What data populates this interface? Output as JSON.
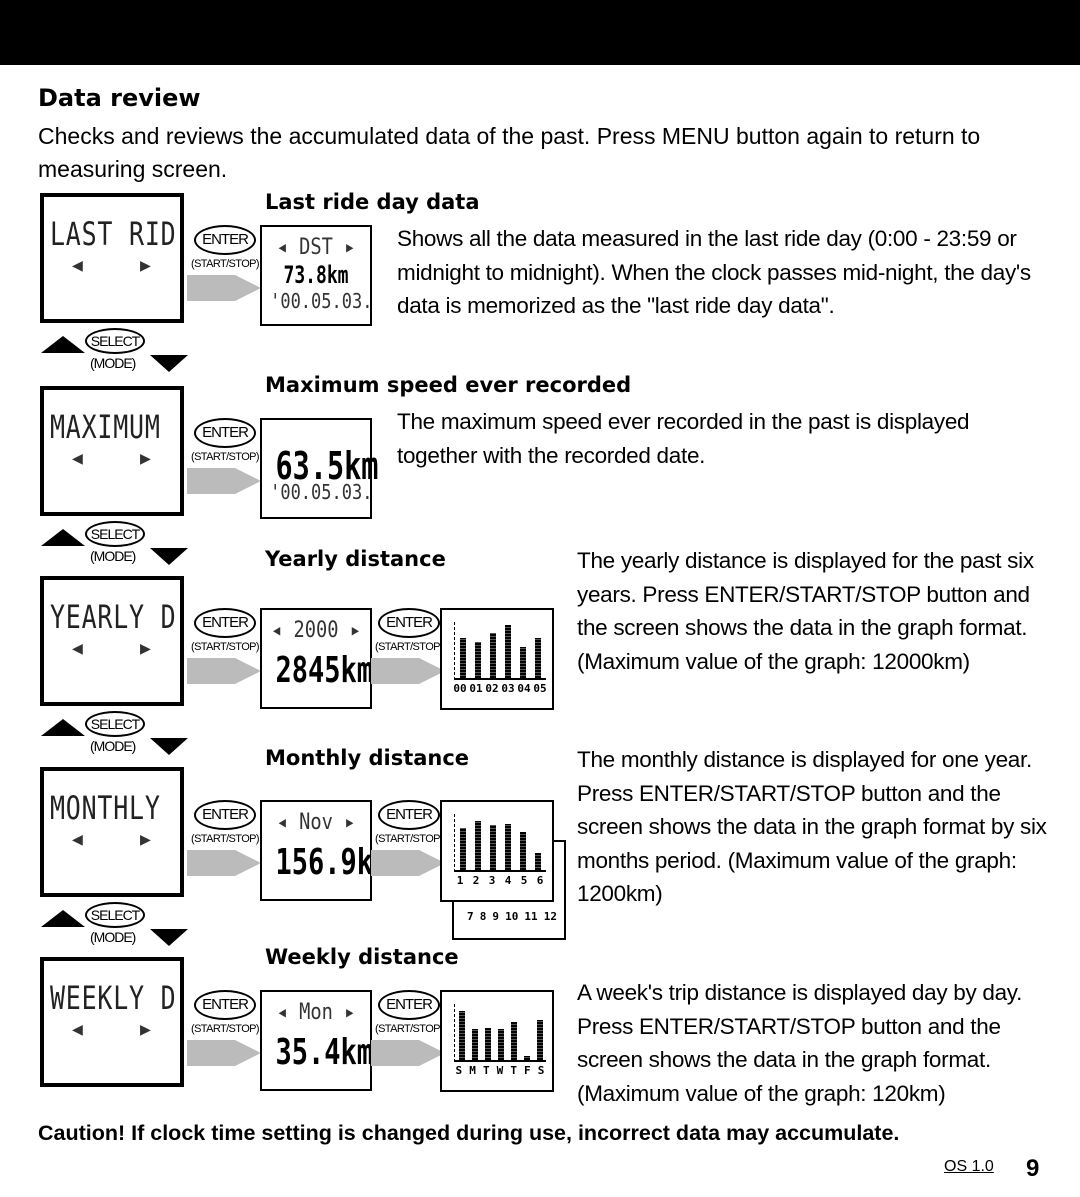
{
  "title": "Data review",
  "intro": "Checks and reviews the accumulated data of the past. Press MENU button again to return to measuring screen.",
  "buttons": {
    "enter": "ENTER",
    "start_stop": "(START/STOP)",
    "select": "SELECT",
    "mode": "(MODE)"
  },
  "sections": [
    {
      "title": "Last ride day data",
      "lcd": "LAST RID",
      "screen": {
        "line1": "◂ DST ▸",
        "line2": "73.8km",
        "line3": "'00.05.03."
      },
      "description": "Shows all the data measured in the last ride day (0:00 - 23:59 or midnight to midnight). When the clock passes mid-night, the day's data is memorized as the \"last ride day data\"."
    },
    {
      "title": "Maximum speed ever recorded",
      "lcd": "MAXIMUM",
      "screen": {
        "line1": "",
        "line2": "63.5km",
        "line3": "'00.05.03."
      },
      "description": "The maximum speed ever recorded in the past is displayed together with the recorded date."
    },
    {
      "title": "Yearly distance",
      "lcd": "YEARLY D",
      "screen": {
        "line1": "◂ 2000 ▸",
        "line2": "2845km",
        "line3": ""
      },
      "description": "The yearly distance is displayed for the past six years. Press ENTER/START/STOP button and the screen shows the data in the graph format. (Maximum value of the graph: 12000km)",
      "graph": {
        "labels": [
          "00",
          "01",
          "02",
          "03",
          "04",
          "05"
        ],
        "values": [
          0.72,
          0.64,
          0.8,
          0.95,
          0.55,
          0.72
        ]
      }
    },
    {
      "title": "Monthly distance",
      "lcd": "MONTHLY",
      "screen": {
        "line1": "◂ Nov ▸",
        "line2": "156.9km",
        "line3": ""
      },
      "description": "The monthly distance is displayed for one year. Press ENTER/START/STOP button and the screen shows the data in the graph format by six months period. (Maximum value of the graph: 1200km)",
      "graph": {
        "labels": [
          "1",
          "2",
          "3",
          "4",
          "5",
          "6"
        ],
        "values": [
          0.75,
          0.88,
          0.8,
          0.83,
          0.68,
          0.3
        ]
      },
      "graph_back_labels": [
        "7",
        "8",
        "9",
        "10",
        "11",
        "12"
      ]
    },
    {
      "title": "Weekly distance",
      "lcd": "WEEKLY D",
      "screen": {
        "line1": "◂ Mon ▸",
        "line2": "35.4km",
        "line3": ""
      },
      "description": "A week's trip distance is displayed day by day. Press ENTER/START/STOP button and the screen shows the data in the graph format. (Maximum value of the graph: 120km)",
      "graph": {
        "labels": [
          "S",
          "M",
          "T",
          "W",
          "T",
          "F",
          "S"
        ],
        "values": [
          0.88,
          0.55,
          0.58,
          0.55,
          0.68,
          0.08,
          0.72
        ]
      }
    }
  ],
  "caution": "Caution! If clock time setting is changed during use, incorrect data may accumulate.",
  "footer": {
    "version": "OS 1.0",
    "page": "9"
  }
}
